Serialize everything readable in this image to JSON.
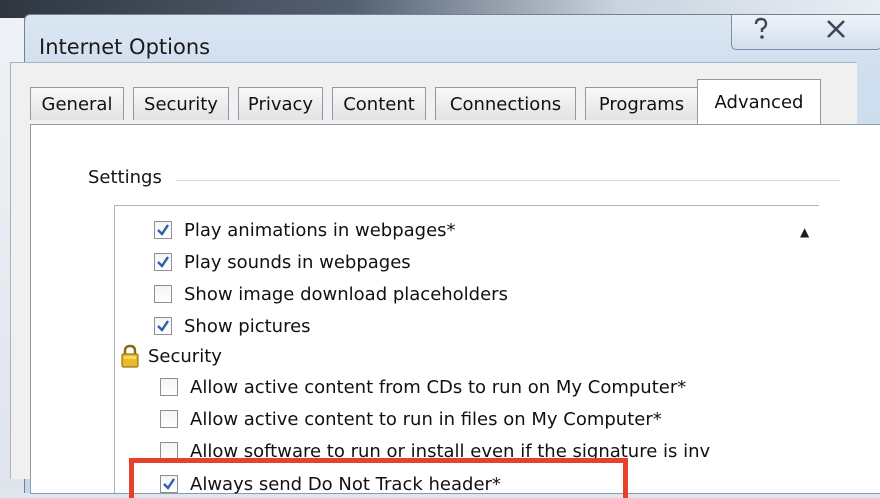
{
  "window": {
    "title": "Internet Options",
    "help_icon": "question-mark",
    "close_icon": "x"
  },
  "tabs": [
    {
      "label": "General",
      "active": false
    },
    {
      "label": "Security",
      "active": false
    },
    {
      "label": "Privacy",
      "active": false
    },
    {
      "label": "Content",
      "active": false
    },
    {
      "label": "Connections",
      "active": false
    },
    {
      "label": "Programs",
      "active": false
    },
    {
      "label": "Advanced",
      "active": true
    }
  ],
  "settings": {
    "group_label": "Settings",
    "items": [
      {
        "type": "checkbox",
        "label": "Play animations in webpages*",
        "checked": true
      },
      {
        "type": "checkbox",
        "label": "Play sounds in webpages",
        "checked": true
      },
      {
        "type": "checkbox",
        "label": "Show image download placeholders",
        "checked": false
      },
      {
        "type": "checkbox",
        "label": "Show pictures",
        "checked": true
      },
      {
        "type": "category",
        "label": "Security",
        "icon": "lock-icon"
      },
      {
        "type": "checkbox",
        "label": "Allow active content from CDs to run on My Computer*",
        "checked": false
      },
      {
        "type": "checkbox",
        "label": "Allow active content to run in files on My Computer*",
        "checked": false
      },
      {
        "type": "checkbox",
        "label": "Allow software to run or install even if the signature is inv",
        "checked": false
      },
      {
        "type": "checkbox",
        "label": "Always send Do Not Track header*",
        "checked": true
      }
    ]
  },
  "highlight_color": "#e8412a"
}
